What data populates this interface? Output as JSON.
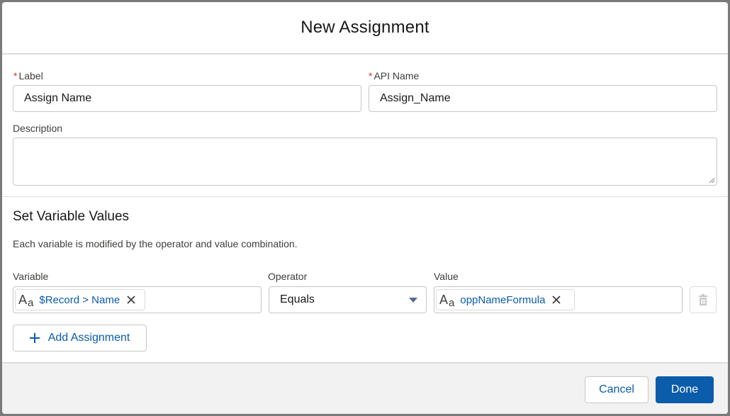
{
  "modal": {
    "title": "New Assignment"
  },
  "fields": {
    "label": {
      "required_mark": "*",
      "label": "Label",
      "value": "Assign Name"
    },
    "api_name": {
      "required_mark": "*",
      "label": "API Name",
      "value": "Assign_Name"
    },
    "description": {
      "label": "Description",
      "value": ""
    }
  },
  "section": {
    "title": "Set Variable Values",
    "help_text": "Each variable is modified by the operator and value combination."
  },
  "assignment_table": {
    "headers": {
      "variable": "Variable",
      "operator": "Operator",
      "value": "Value"
    },
    "rows": [
      {
        "variable": {
          "icon": "text-type-icon",
          "icon_big": "A",
          "icon_small": "a",
          "text": "$Record > Name"
        },
        "operator": "Equals",
        "value": {
          "icon": "text-type-icon",
          "icon_big": "A",
          "icon_small": "a",
          "text": "oppNameFormula"
        }
      }
    ]
  },
  "add_assignment": {
    "icon": "plus-icon",
    "label": "Add Assignment"
  },
  "footer": {
    "cancel_label": "Cancel",
    "done_label": "Done"
  },
  "colors": {
    "brand": "#0b5cab",
    "required": "#c23934",
    "pill_text": "#0b5cab",
    "footer_bg": "#f3f2f2"
  }
}
